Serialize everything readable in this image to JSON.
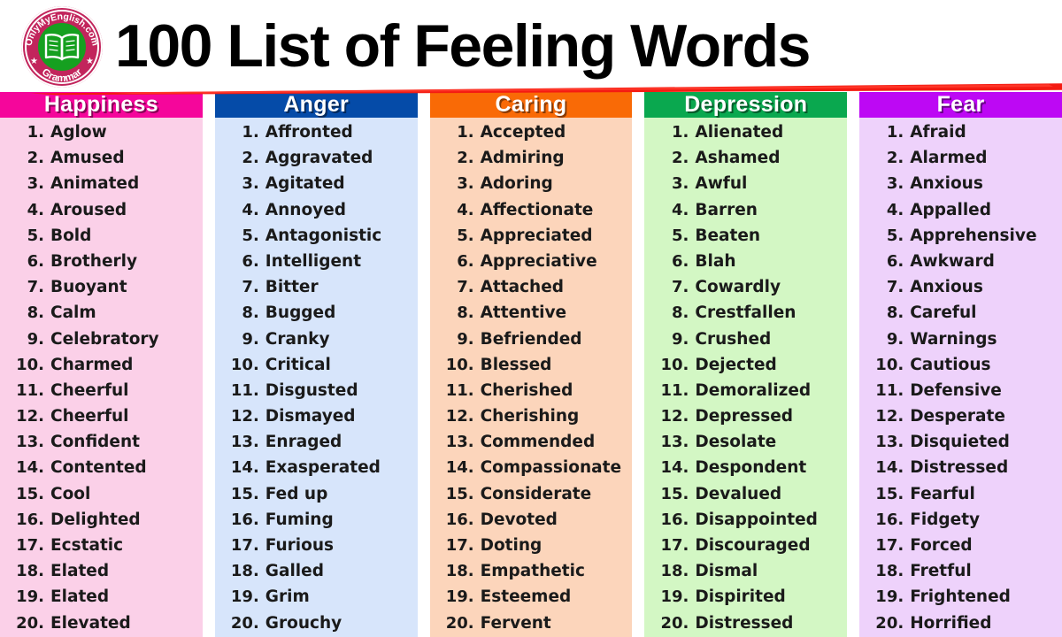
{
  "header": {
    "title": "100 List of Feeling Words",
    "logo": {
      "top_text": "OnlyMyEnglish.com",
      "bottom_text": "Grammar",
      "icon": "open-book-icon",
      "badge_color": "#c2255c",
      "inner_color": "#16a020"
    },
    "rule_color": "#f41b12"
  },
  "columns": [
    {
      "header": "Happiness",
      "header_color": "#f5069b",
      "body_color": "#fbd0e8",
      "items": [
        "Aglow",
        "Amused",
        "Animated",
        "Aroused",
        "Bold",
        "Brotherly",
        "Buoyant",
        "Calm",
        "Celebratory",
        "Charmed",
        "Cheerful",
        "Cheerful",
        "Confident",
        "Contented",
        "Cool",
        "Delighted",
        "Ecstatic",
        "Elated",
        "Elated",
        "Elevated"
      ]
    },
    {
      "header": "Anger",
      "header_color": "#054ba8",
      "body_color": "#d7e5fb",
      "items": [
        "Affronted",
        "Aggravated",
        "Agitated",
        "Annoyed",
        "Antagonistic",
        "Intelligent",
        "Bitter",
        "Bugged",
        "Cranky",
        "Critical",
        "Disgusted",
        "Dismayed",
        "Enraged",
        "Exasperated",
        "Fed up",
        "Fuming",
        "Furious",
        "Galled",
        "Grim",
        "Grouchy"
      ]
    },
    {
      "header": "Caring",
      "header_color": "#f96a06",
      "body_color": "#fcd5bb",
      "items": [
        "Accepted",
        "Admiring",
        "Adoring",
        "Affectionate",
        "Appreciated",
        "Appreciative",
        "Attached",
        "Attentive",
        "Befriended",
        "Blessed",
        "Cherished",
        "Cherishing",
        "Commended",
        "Compassionate",
        "Considerate",
        "Devoted",
        "Doting",
        "Empathetic",
        "Esteemed",
        "Fervent"
      ]
    },
    {
      "header": "Depression",
      "header_color": "#0aa84f",
      "body_color": "#d3f7c4",
      "items": [
        "Alienated",
        "Ashamed",
        "Awful",
        "Barren",
        "Beaten",
        "Blah",
        "Cowardly",
        "Crestfallen",
        "Crushed",
        "Dejected",
        "Demoralized",
        "Depressed",
        "Desolate",
        "Despondent",
        "Devalued",
        "Disappointed",
        "Discouraged",
        "Dismal",
        "Dispirited",
        "Distressed"
      ]
    },
    {
      "header": "Fear",
      "header_color": "#bd08f4",
      "body_color": "#eed2fb",
      "items": [
        "Afraid",
        "Alarmed",
        "Anxious",
        "Appalled",
        "Apprehensive",
        "Awkward",
        "Anxious",
        "Careful",
        "Warnings",
        "Cautious",
        "Defensive",
        "Desperate",
        "Disquieted",
        "Distressed",
        "Fearful",
        "Fidgety",
        "Forced",
        "Fretful",
        "Frightened",
        "Horrified"
      ]
    }
  ]
}
